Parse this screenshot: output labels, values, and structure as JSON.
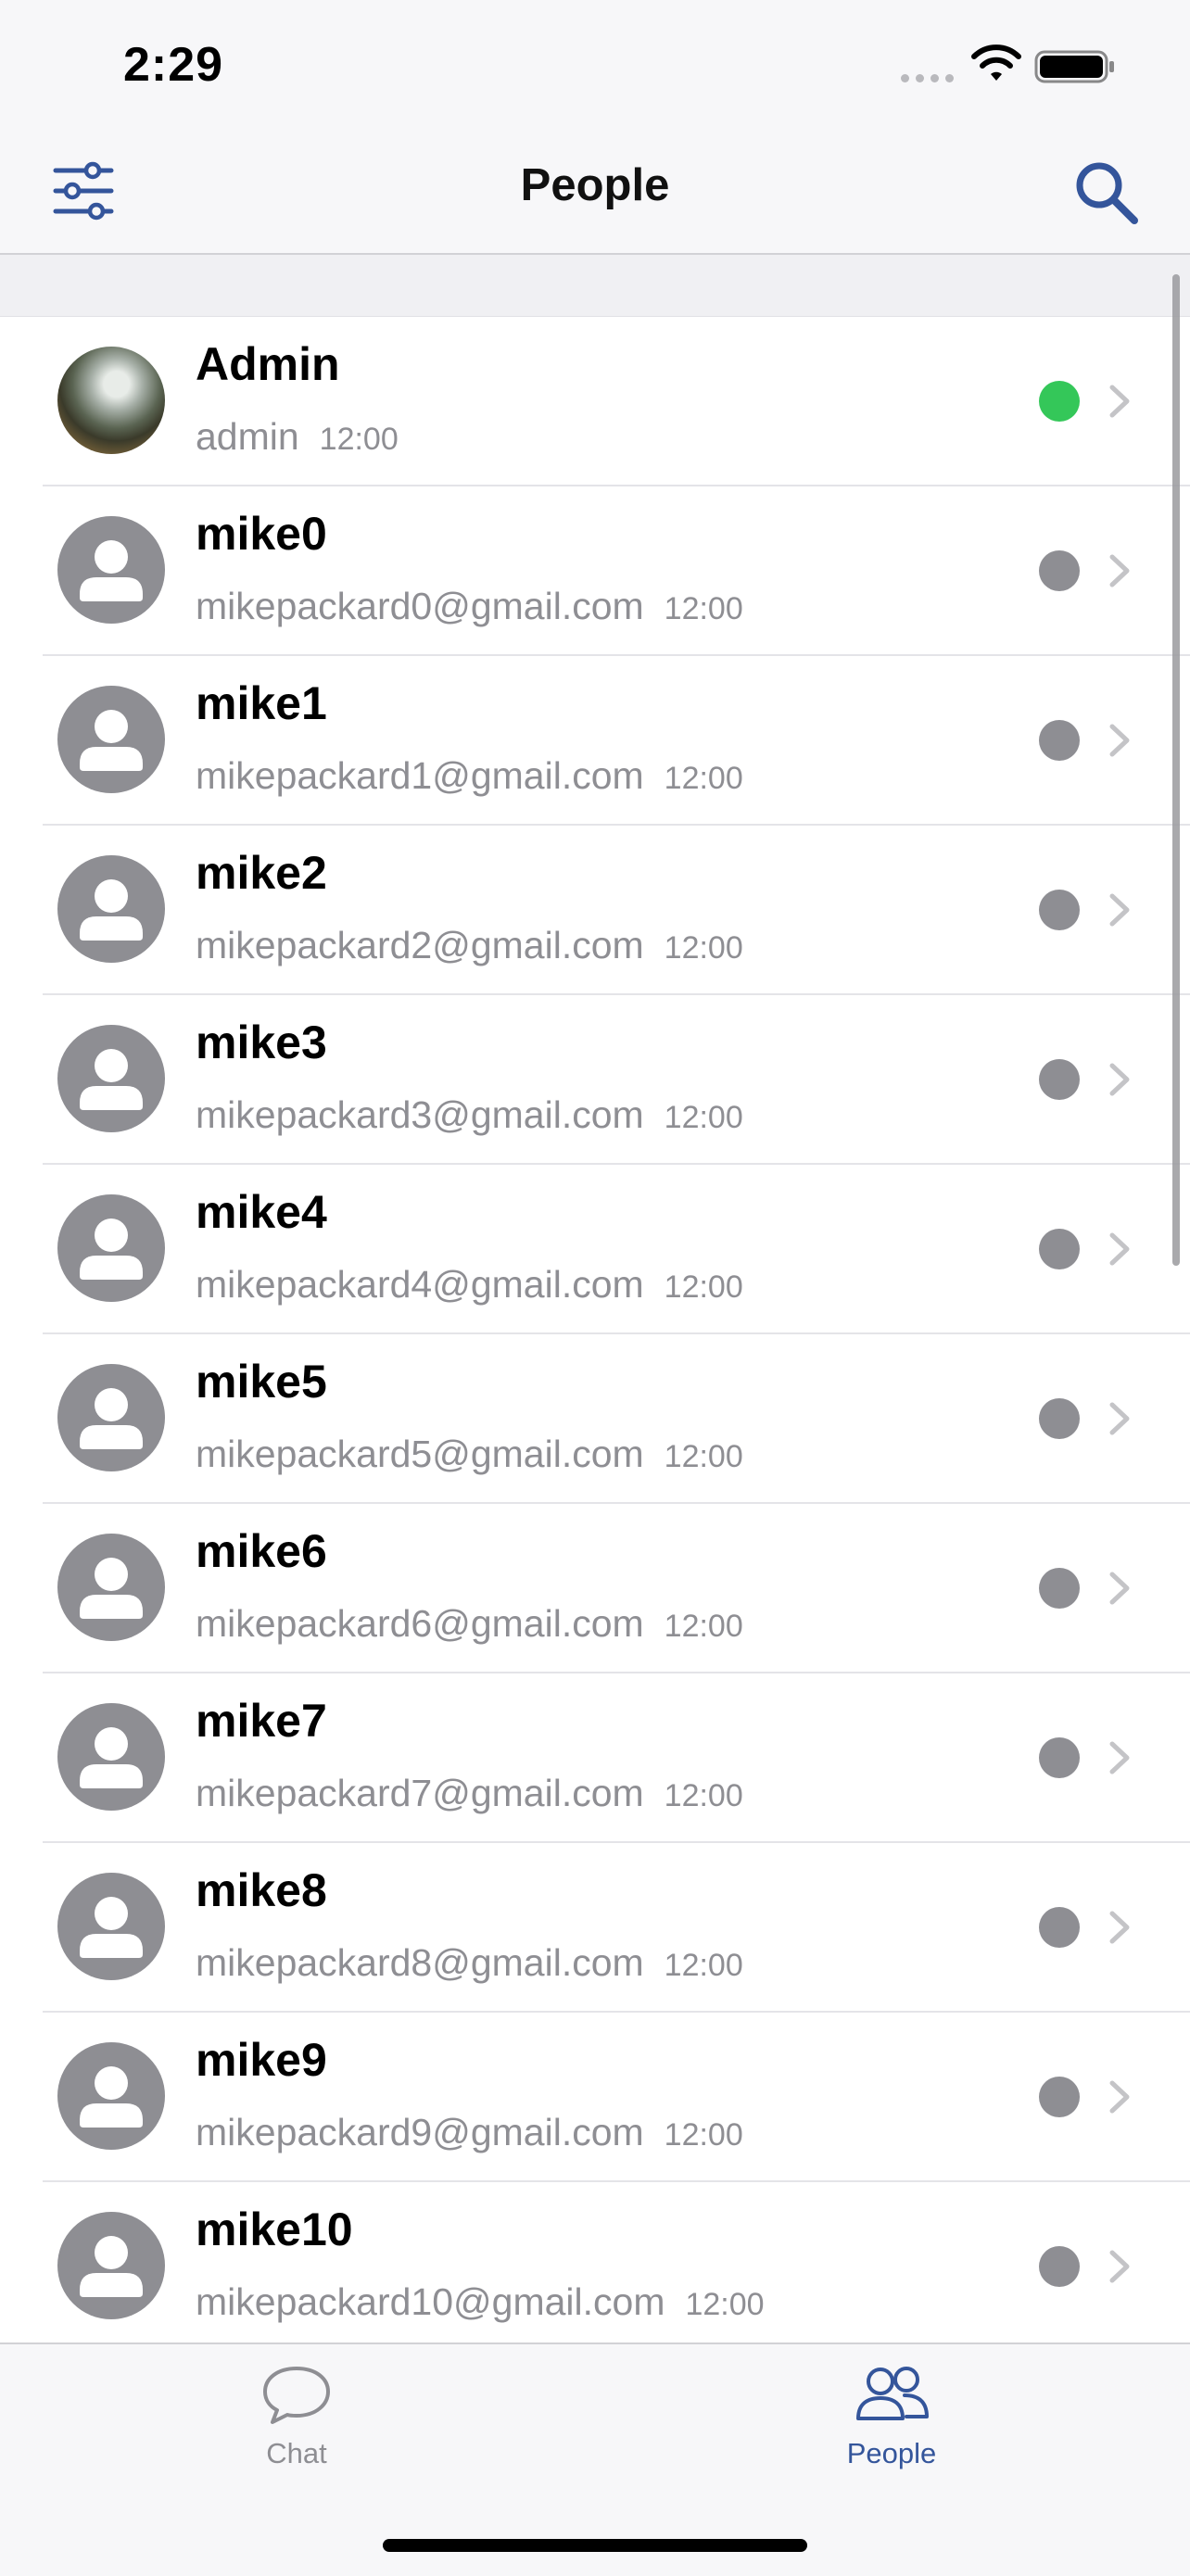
{
  "status_bar": {
    "time": "2:29"
  },
  "nav": {
    "title": "People"
  },
  "people": [
    {
      "name": "Admin",
      "detail": "admin",
      "time": "12:00",
      "online": true
    },
    {
      "name": "mike0",
      "detail": "mikepackard0@gmail.com",
      "time": "12:00",
      "online": false
    },
    {
      "name": "mike1",
      "detail": "mikepackard1@gmail.com",
      "time": "12:00",
      "online": false
    },
    {
      "name": "mike2",
      "detail": "mikepackard2@gmail.com",
      "time": "12:00",
      "online": false
    },
    {
      "name": "mike3",
      "detail": "mikepackard3@gmail.com",
      "time": "12:00",
      "online": false
    },
    {
      "name": "mike4",
      "detail": "mikepackard4@gmail.com",
      "time": "12:00",
      "online": false
    },
    {
      "name": "mike5",
      "detail": "mikepackard5@gmail.com",
      "time": "12:00",
      "online": false
    },
    {
      "name": "mike6",
      "detail": "mikepackard6@gmail.com",
      "time": "12:00",
      "online": false
    },
    {
      "name": "mike7",
      "detail": "mikepackard7@gmail.com",
      "time": "12:00",
      "online": false
    },
    {
      "name": "mike8",
      "detail": "mikepackard8@gmail.com",
      "time": "12:00",
      "online": false
    },
    {
      "name": "mike9",
      "detail": "mikepackard9@gmail.com",
      "time": "12:00",
      "online": false
    },
    {
      "name": "mike10",
      "detail": "mikepackard10@gmail.com",
      "time": "12:00",
      "online": false
    }
  ],
  "tabs": [
    {
      "label": "Chat",
      "icon": "chat-bubble-icon",
      "active": false
    },
    {
      "label": "People",
      "icon": "people-icon",
      "active": true
    }
  ],
  "colors": {
    "accent": "#34559b",
    "online": "#34c759",
    "offline": "#8e8e93",
    "secondary_text": "#8e8e93"
  }
}
